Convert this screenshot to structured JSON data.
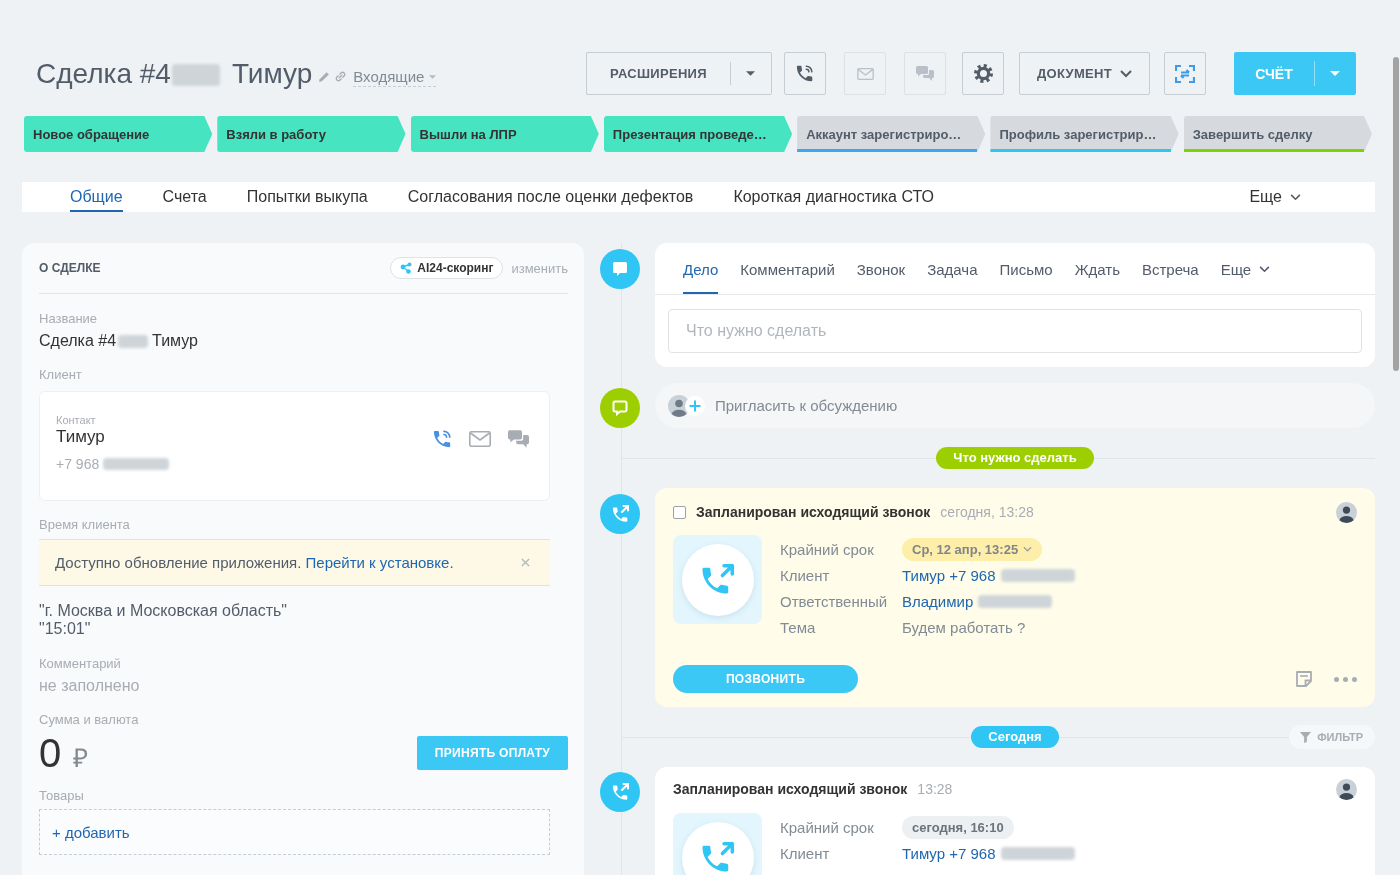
{
  "header": {
    "title_start": "Сделка #4",
    "title_redacted": true,
    "title_end": "Тимур",
    "category": "Входящие"
  },
  "toolbar": {
    "extensions": "РАСШИРЕНИЯ",
    "call_disabled": false,
    "mail_disabled": true,
    "chat_disabled": true,
    "document": "ДОКУМЕНТ",
    "invoice": "СЧЁТ"
  },
  "stages": [
    {
      "label": "Новое обращение",
      "reached": true,
      "color": "#47e4c2"
    },
    {
      "label": "Взяли в работу",
      "reached": true,
      "color": "#47e4c2"
    },
    {
      "label": "Вышли на ЛПР",
      "reached": true,
      "color": "#47e4c2"
    },
    {
      "label": "Презентация проведе…",
      "reached": true,
      "color": "#47e4c2"
    },
    {
      "label": "Аккаунт зарегистриро…",
      "reached": false,
      "color": "#39a8ef"
    },
    {
      "label": "Профиль зарегистрир…",
      "reached": false,
      "color": "#2fc6f6"
    },
    {
      "label": "Завершить сделку",
      "reached": false,
      "color": "#7bd500"
    }
  ],
  "tabs": {
    "items": [
      {
        "label": "Общие",
        "selected": true
      },
      {
        "label": "Счета",
        "selected": false
      },
      {
        "label": "Попытки выкупа",
        "selected": false
      },
      {
        "label": "Согласования после оценки дефектов",
        "selected": false
      },
      {
        "label": "Короткая диагностика СТО",
        "selected": false
      }
    ],
    "more": "Еще"
  },
  "deal": {
    "title": "О СДЕЛКЕ",
    "scoring": "AI24-скоринг",
    "edit": "изменить",
    "name_label": "Название",
    "name_start": "Сделка #4",
    "name_redacted": true,
    "name_end": "Тимур",
    "client_label": "Клиент",
    "contact_type": "Контакт",
    "contact_name": "Тимур",
    "contact_phone": "+7 968",
    "phone_redacted": true,
    "client_time_label": "Время клиента",
    "notice": "Доступно обновление приложения.",
    "notice_link": "Перейти к установке.",
    "region": "\"г. Москва и Московская область\"",
    "local_time": "\"15:01\"",
    "comment_label": "Комментарий",
    "comment": "не заполнено",
    "amount_label": "Сумма и валюта",
    "amount": "0",
    "currency": "₽",
    "pay_button": "ПРИНЯТЬ ОПЛАТУ",
    "products_label": "Товары",
    "add_product": "+ добавить"
  },
  "timeline": {
    "composer": {
      "tabs": [
        {
          "label": "Дело",
          "selected": true
        },
        {
          "label": "Комментарий",
          "selected": false
        },
        {
          "label": "Звонок",
          "selected": false
        },
        {
          "label": "Задача",
          "selected": false
        },
        {
          "label": "Письмо",
          "selected": false
        },
        {
          "label": "Ждать",
          "selected": false
        },
        {
          "label": "Встреча",
          "selected": false
        }
      ],
      "more": "Еще",
      "placeholder": "Что нужно сделать"
    },
    "invite": "Пригласить к обсуждению",
    "sections": [
      {
        "kind": "planned",
        "label": "Что нужно сделать",
        "items": [
          {
            "title": "Запланирован исходящий звонок",
            "time": "сегодня, 13:28",
            "checked": false,
            "rows": [
              {
                "kind": "deadline",
                "label": "Крайний срок",
                "value": "Ср, 12 апр, 13:25"
              },
              {
                "kind": "link",
                "label": "Клиент",
                "value": "Тимур +7 968",
                "redacted": true
              },
              {
                "kind": "link",
                "label": "Ответственный",
                "value": "Владимир",
                "redacted": true
              },
              {
                "kind": "text",
                "label": "Тема",
                "value": "Будем работать ?"
              }
            ],
            "action": "ПОЗВОНИТЬ"
          }
        ]
      },
      {
        "kind": "history",
        "label": "Сегодня",
        "filter": "ФИЛЬТР",
        "items": [
          {
            "title": "Запланирован исходящий звонок",
            "time": "13:28",
            "rows": [
              {
                "kind": "deadline",
                "label": "Крайний срок",
                "value": "сегодня, 16:10"
              },
              {
                "kind": "link",
                "label": "Клиент",
                "value": "Тимур +7 968",
                "redacted": true
              }
            ]
          }
        ]
      }
    ]
  }
}
